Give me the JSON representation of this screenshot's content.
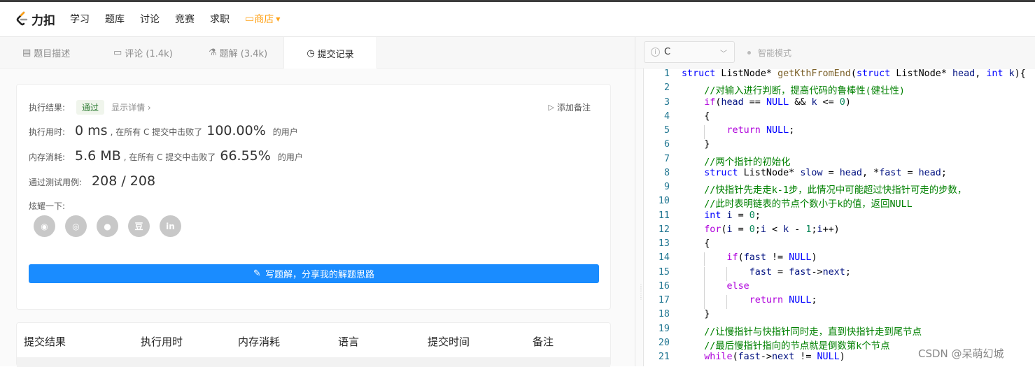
{
  "topbar": {
    "logo_text": "力扣",
    "nav": [
      "学习",
      "题库",
      "讨论",
      "竞赛",
      "求职"
    ],
    "store": "商店"
  },
  "tabs": [
    {
      "icon": "description-icon",
      "label": "题目描述"
    },
    {
      "icon": "comment-icon",
      "label": "评论 (1.4k)"
    },
    {
      "icon": "flask-icon",
      "label": "题解 (3.4k)"
    },
    {
      "icon": "clock-icon",
      "label": "提交记录"
    }
  ],
  "editor_bar": {
    "language": "C",
    "smart_mode": "智能模式"
  },
  "result": {
    "exec_label": "执行结果:",
    "status": "通过",
    "show_detail": "显示详情",
    "add_note": "添加备注",
    "time_label": "执行用时:",
    "time_value": "0 ms",
    "time_mid": ", 在所有 C 提交中击败了",
    "time_pct": "100.00%",
    "time_suffix": "的用户",
    "mem_label": "内存消耗:",
    "mem_value": "5.6 MB",
    "mem_mid": ", 在所有 C 提交中击败了",
    "mem_pct": "66.55%",
    "mem_suffix": "的用户",
    "cases_label": "通过测试用例:",
    "cases_value": "208 / 208",
    "share_label": "炫耀一下:",
    "write_button": "写题解，分享我的解题思路"
  },
  "shares": [
    {
      "icon": "wechat-icon",
      "glyph": "◉"
    },
    {
      "icon": "weibo-icon",
      "glyph": "◎"
    },
    {
      "icon": "qq-icon",
      "glyph": "●"
    },
    {
      "icon": "douban-icon",
      "glyph": "豆"
    },
    {
      "icon": "linkedin-icon",
      "glyph": "in"
    }
  ],
  "table_headers": [
    "提交结果",
    "执行用时",
    "内存消耗",
    "语言",
    "提交时间",
    "备注"
  ],
  "code_lines": [
    "struct ListNode* getKthFromEnd(struct ListNode* head, int k){",
    "    //对输入进行判断，提高代码的鲁棒性(健壮性)",
    "    if(head == NULL && k <= 0)",
    "    {",
    "        return NULL;",
    "    }",
    "    //两个指针的初始化",
    "    struct ListNode* slow = head, *fast = head;",
    "    //快指针先走走k-1步，此情况中可能超过快指针可走的步数，",
    "    //此时表明链表的节点个数小于k的值，返回NULL",
    "    int i = 0;",
    "    for(i = 0;i < k - 1;i++)",
    "    {",
    "        if(fast != NULL)",
    "            fast = fast->next;",
    "        else",
    "            return NULL;",
    "    }",
    "    //让慢指针与快指针同时走，直到快指针走到尾节点",
    "    //最后慢指针指向的节点就是倒数第k个节点",
    "    while(fast->next != NULL)"
  ],
  "watermark": "CSDN @呆萌幻城"
}
